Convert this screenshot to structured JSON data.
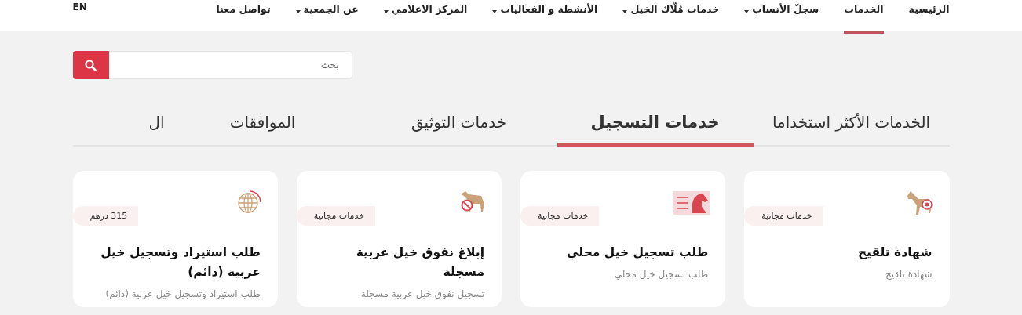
{
  "language_link": "EN",
  "nav": [
    {
      "label": "الرئيسية",
      "selected": false,
      "dropdown": false
    },
    {
      "label": "الخدمات",
      "selected": true,
      "dropdown": false
    },
    {
      "label": "سجلّ الأنساب",
      "selected": false,
      "dropdown": true
    },
    {
      "label": "خدمات مُلّاك الخيل",
      "selected": false,
      "dropdown": true
    },
    {
      "label": "الأنشطة و الفعاليات",
      "selected": false,
      "dropdown": true
    },
    {
      "label": "المركز الاعلامي",
      "selected": false,
      "dropdown": true
    },
    {
      "label": "عن الجمعية",
      "selected": false,
      "dropdown": true
    },
    {
      "label": "تواصل معنا",
      "selected": false,
      "dropdown": false
    }
  ],
  "search": {
    "placeholder": "بحث"
  },
  "tabs": [
    {
      "label": "الخدمات الأكثر استخداما",
      "selected": false
    },
    {
      "label": "خدمات التسجيل",
      "selected": true
    },
    {
      "label": "خدمات التوثيق",
      "selected": false
    },
    {
      "label": "الموافقات",
      "selected": false
    },
    {
      "label": "ال",
      "selected": false
    }
  ],
  "cards": [
    {
      "badge": "خدمات مجانية",
      "title": "شهادة تلقيح",
      "subtitle": "شهادة تلقيح"
    },
    {
      "badge": "خدمات مجانية",
      "title": "طلب تسجيل خيل محلي",
      "subtitle": "طلب تسجيل خيل محلي"
    },
    {
      "badge": "خدمات مجانية",
      "title": "إبلاغ نفوق خيل عربية مسجلة",
      "subtitle": "تسجيل نفوق خيل عربية مسجلة"
    },
    {
      "badge": "315 درهم",
      "title": "طلب استيراد وتسجيل خيل عربية (دائم)",
      "subtitle": "طلب استيراد وتسجيل خيل عربية (دائم)"
    }
  ]
}
